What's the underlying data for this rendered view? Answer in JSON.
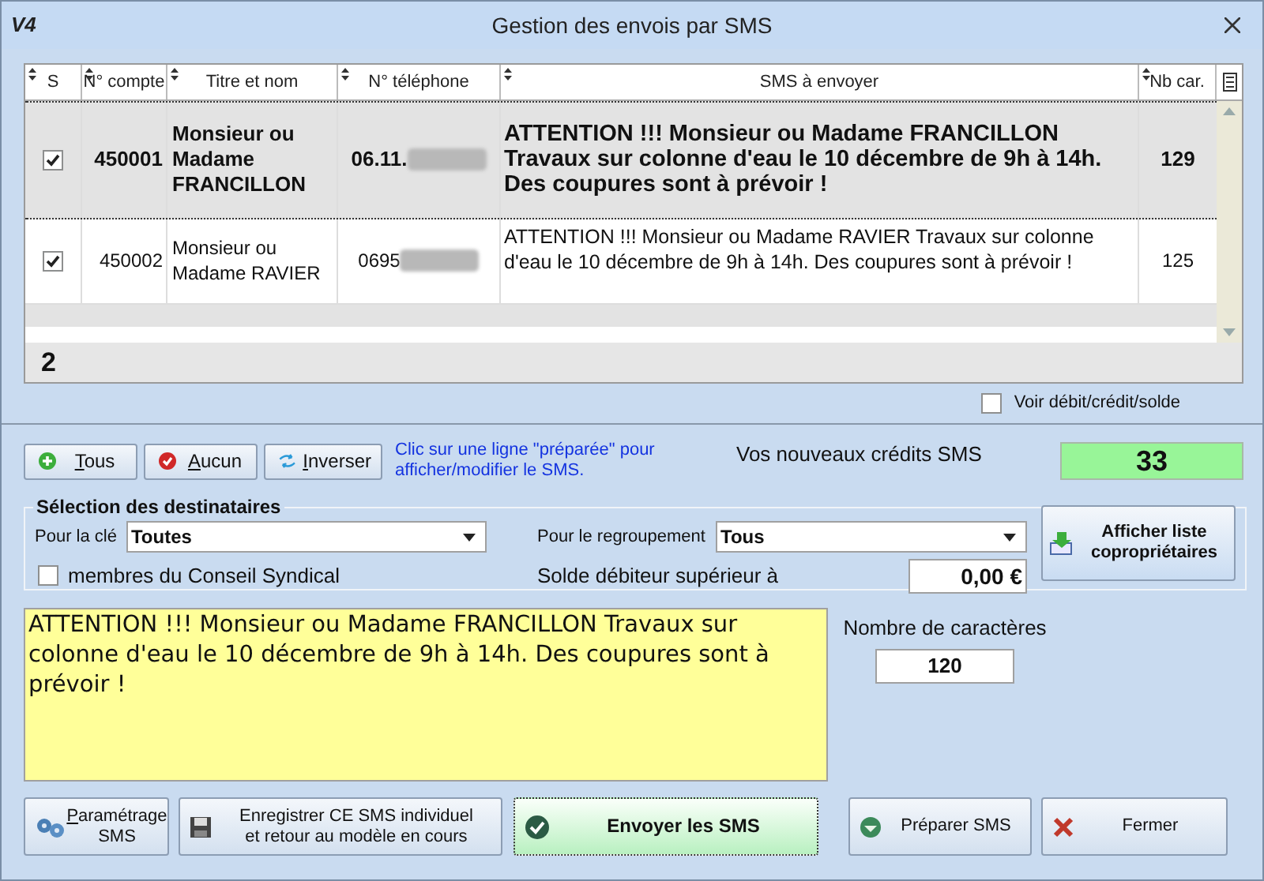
{
  "window": {
    "title": "Gestion des envois par SMS",
    "logo": "V4"
  },
  "grid": {
    "columns": [
      {
        "label": "S"
      },
      {
        "label": "N° compte"
      },
      {
        "label": "Titre et nom"
      },
      {
        "label": "N° téléphone"
      },
      {
        "label": "SMS à envoyer"
      },
      {
        "label": "Nb car."
      }
    ],
    "rows": [
      {
        "checked": true,
        "selected": true,
        "account": "450001",
        "name": "Monsieur ou Madame FRANCILLON",
        "phone": "06.11.",
        "sms": "ATTENTION !!! Monsieur ou Madame FRANCILLON Travaux sur colonne d'eau le 10 décembre de 9h à 14h. Des coupures sont à prévoir !",
        "count": "129"
      },
      {
        "checked": true,
        "selected": false,
        "account": "450002",
        "name": "Monsieur ou Madame RAVIER",
        "phone": "0695",
        "sms": "ATTENTION !!! Monsieur ou Madame RAVIER Travaux sur colonne d'eau le 10 décembre de 9h à 14h. Des coupures sont à prévoir !",
        "count": "125"
      }
    ],
    "footer_count": "2"
  },
  "show_balance": {
    "label": "Voir débit/crédit/solde",
    "checked": false
  },
  "select_buttons": [
    {
      "label": "Tous",
      "kind": "add"
    },
    {
      "label": "Aucun",
      "kind": "remove"
    },
    {
      "label": "Inverser",
      "kind": "swap"
    }
  ],
  "hint": "Clic sur une ligne \"préparée\" pour afficher/modifier le SMS.",
  "credits": {
    "label": "Vos nouveaux crédits SMS",
    "value": "33"
  },
  "recipients": {
    "title": "Sélection des destinataires",
    "key_label": "Pour la clé",
    "key_value": "Toutes",
    "group_label": "Pour le regroupement",
    "group_value": "Tous",
    "council": {
      "label": "membres du Conseil Syndical",
      "checked": false
    },
    "balance_label": "Solde débiteur supérieur à",
    "balance_value": "0,00 €",
    "list_button": "Afficher liste\ncopropriétaires"
  },
  "message": {
    "text": "ATTENTION !!! Monsieur ou Madame FRANCILLON Travaux sur colonne d'eau le 10 décembre de 9h à 14h. Des coupures sont à prévoir !",
    "count_label": "Nombre de caractères",
    "count": "120"
  },
  "actions": [
    {
      "label": "Paramétrage\nSMS",
      "kind": "settings"
    },
    {
      "label": "Enregistrer CE SMS individuel\net retour au modèle en cours",
      "kind": "save"
    },
    {
      "label": "Envoyer les SMS",
      "kind": "send"
    },
    {
      "label": "Préparer SMS",
      "kind": "prepare"
    },
    {
      "label": "Fermer",
      "kind": "close"
    }
  ]
}
